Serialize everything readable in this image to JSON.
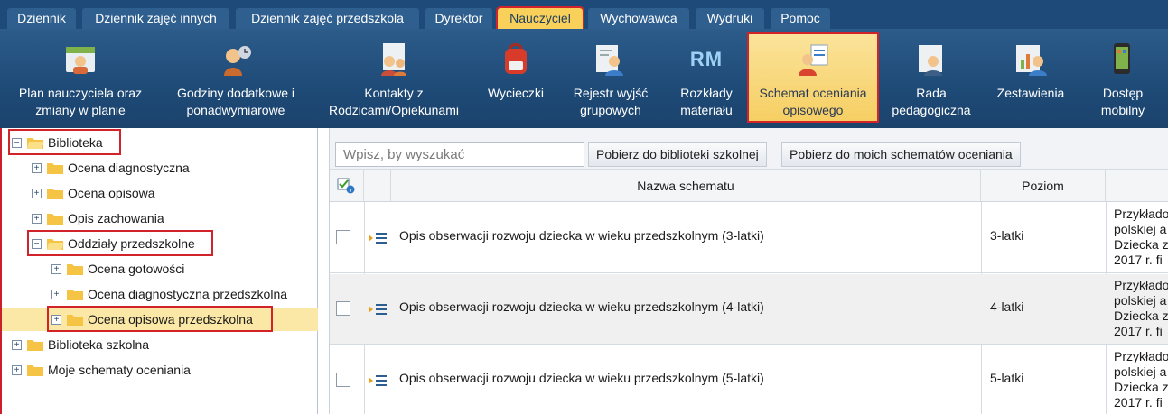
{
  "tabs": [
    {
      "label": "Dziennik",
      "active": false
    },
    {
      "label": "Dziennik zajęć innych",
      "active": false
    },
    {
      "label": "Dziennik zajęć przedszkola",
      "active": false
    },
    {
      "label": "Dyrektor",
      "active": false
    },
    {
      "label": "Nauczyciel",
      "active": true
    },
    {
      "label": "Wychowawca",
      "active": false
    },
    {
      "label": "Wydruki",
      "active": false
    },
    {
      "label": "Pomoc",
      "active": false
    }
  ],
  "toolbar": [
    {
      "label": "Plan nauczyciela oraz\nzmiany w planie",
      "icon": "teacher-plan-icon"
    },
    {
      "label": "Godziny dodatkowe i\nponadwymiarowe",
      "icon": "extra-hours-icon"
    },
    {
      "label": "Kontakty z\nRodzicami/Opiekunami",
      "icon": "parent-contacts-icon"
    },
    {
      "label": "Wycieczki",
      "icon": "backpack-icon"
    },
    {
      "label": "Rejestr wyjść\ngrupowych",
      "icon": "group-outings-icon"
    },
    {
      "label": "Rozkłady\nmateriału",
      "icon": "rm-icon",
      "icon_text": "RM"
    },
    {
      "label": "Schemat oceniania\nopisowego",
      "icon": "descriptive-assessment-icon",
      "active": true
    },
    {
      "label": "Rada\npedagogiczna",
      "icon": "teachers-council-icon"
    },
    {
      "label": "Zestawienia",
      "icon": "reports-icon"
    },
    {
      "label": "Dostęp\nmobilny",
      "icon": "mobile-access-icon"
    }
  ],
  "tree": [
    {
      "label": "Biblioteka",
      "expanded": true,
      "level": 0
    },
    {
      "label": "Ocena diagnostyczna",
      "expanded": false,
      "level": 1
    },
    {
      "label": "Ocena opisowa",
      "expanded": false,
      "level": 1
    },
    {
      "label": "Opis zachowania",
      "expanded": false,
      "level": 1
    },
    {
      "label": "Oddziały przedszkolne",
      "expanded": true,
      "level": 1
    },
    {
      "label": "Ocena gotowości",
      "expanded": false,
      "level": 2
    },
    {
      "label": "Ocena diagnostyczna przedszkolna",
      "expanded": false,
      "level": 2
    },
    {
      "label": "Ocena opisowa przedszkolna",
      "expanded": false,
      "level": 2,
      "selected": true
    },
    {
      "label": "Biblioteka szkolna",
      "expanded": false,
      "level": 0
    },
    {
      "label": "Moje schematy oceniania",
      "expanded": false,
      "level": 0
    }
  ],
  "search": {
    "placeholder": "Wpisz, by wyszukać"
  },
  "buttons": {
    "to_school_library": "Pobierz do biblioteki szkolnej",
    "to_my_schemes": "Pobierz do moich schematów oceniania"
  },
  "grid": {
    "headers": {
      "name": "Nazwa schematu",
      "level": "Poziom"
    },
    "rows": [
      {
        "name": "Opis obserwacji rozwoju dziecka w wieku przedszkolnym (3-latki)",
        "level": "3-latki",
        "desc": "Przykłado\npolskiej a\nDziecka z\n2017 r. fi"
      },
      {
        "name": "Opis obserwacji rozwoju dziecka w wieku przedszkolnym (4-latki)",
        "level": "4-latki",
        "desc": "Przykłado\npolskiej a\nDziecka z\n2017 r. fi"
      },
      {
        "name": "Opis obserwacji rozwoju dziecka w wieku przedszkolnym (5-latki)",
        "level": "5-latki",
        "desc": "Przykłado\npolskiej a\nDziecka z\n2017 r. fi"
      }
    ]
  },
  "colors": {
    "accent": "#f9d15a",
    "highlight": "#d2232a",
    "nav": "#1d4a78"
  }
}
